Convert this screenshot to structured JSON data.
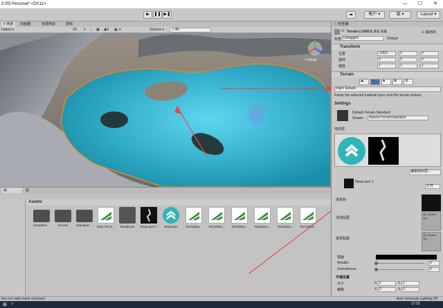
{
  "window": {
    "title": "3.0f3 Personal* <DX11>",
    "controls": [
      "—",
      "☐",
      "✕"
    ]
  },
  "toolbar": {
    "play": "▶",
    "pause": "❚❚",
    "step": "▶❚",
    "account": "帐户",
    "layers": "层",
    "layout": "Layout"
  },
  "scene_tabs": [
    {
      "label": "场景"
    },
    {
      "label": "动画器"
    },
    {
      "label": "资源商店"
    },
    {
      "label": "游戏"
    }
  ],
  "scene_bar": {
    "shading": "haded",
    "mode": "2D",
    "gizmos": "Gizmos",
    "search": "All",
    "persp": "< Persp"
  },
  "project": {
    "header": "Assets",
    "assets": [
      {
        "label": "SampleSc...",
        "type": "folder"
      },
      {
        "label": "Scenes",
        "type": "folder"
      },
      {
        "label": "Standard ...",
        "type": "folder"
      },
      {
        "label": "New Terrai...",
        "type": "terrain"
      },
      {
        "label": "NewBrush",
        "type": "brush"
      },
      {
        "label": "NewLayer 1",
        "type": "flower"
      },
      {
        "label": "NewLayer",
        "type": "arrow"
      },
      {
        "label": "TerrainDa...",
        "type": "terrain"
      },
      {
        "label": "TerrainDa...",
        "type": "terrain"
      },
      {
        "label": "TerrainDa...",
        "type": "terrain"
      },
      {
        "label": "TerrainDa...",
        "type": "terrain"
      },
      {
        "label": "TerrainDa...",
        "type": "terrain"
      },
      {
        "label": "TerrainDa...",
        "type": "terrain"
      }
    ]
  },
  "inspector": {
    "tab": "检查器",
    "object_name": "Terrain (-1000.0, 0.0, 0.0)",
    "static": "静态的",
    "tag_label": "标签",
    "tag_value": "Untagged",
    "layer_label": "图层",
    "layer_value": "Default",
    "transform": {
      "title": "Transform",
      "rows": [
        {
          "label": "位置",
          "x": "-1000",
          "y": "0",
          "z": "0"
        },
        {
          "label": "旋转",
          "x": "0",
          "y": "0",
          "z": "0"
        },
        {
          "label": "缩放",
          "x": "1",
          "y": "1",
          "z": "1"
        }
      ]
    },
    "terrain": {
      "title": "Terrain",
      "dropdown": "Paint Texture",
      "description": "Paints the selected material layer onto the terrain texture",
      "settings": "Settings",
      "material": "Default-Terrain-Standard",
      "shader_label": "Shader",
      "shader_value": "Nature/Terrain/Standard",
      "layers_label": "地形层",
      "edit_layers": "编辑地形层...",
      "layer_name": "NewLayer 1",
      "open": "打开",
      "diffuse": "漫反射",
      "normal": "法线贴图",
      "mask": "遮罩贴图",
      "none_texture": "无 (Texture 2D)",
      "select": "Select",
      "specular": "镜面",
      "metallic": "Metallic",
      "metallic_value": "0",
      "smoothness": "Smoothness",
      "smoothness_value": "0",
      "tiling_title": "平铺设置",
      "size_label": "大小",
      "size_x": "2",
      "size_y": "2",
      "offset_label": "偏移",
      "offset_x": "0",
      "offset_y": "0"
    }
  },
  "statusbar": {
    "left": "ties (no valid mesh renderer)",
    "right": "Auto Generate Lighting Off"
  },
  "taskbar": {
    "time": "17:23"
  },
  "colors": {
    "terrain_cyan": "#39b5d3",
    "arrow_red": "#e5474b",
    "teal_logo": "#1bb3b5"
  }
}
